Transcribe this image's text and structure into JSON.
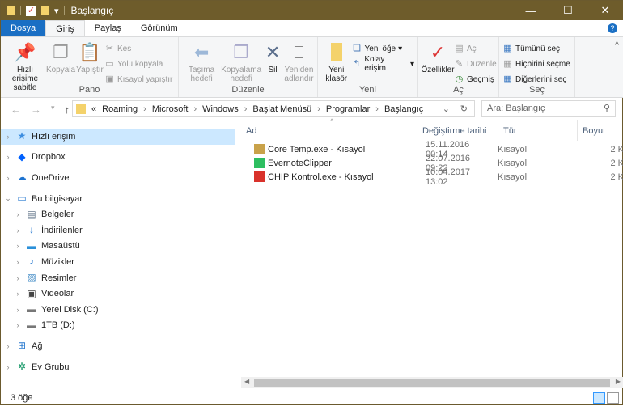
{
  "window": {
    "title": "Başlangıç",
    "minimize": "—",
    "maximize": "☐",
    "close": "✕"
  },
  "tabs": [
    {
      "label": "Dosya"
    },
    {
      "label": "Giriş"
    },
    {
      "label": "Paylaş"
    },
    {
      "label": "Görünüm"
    }
  ],
  "help": "?",
  "ribbon": {
    "pano": {
      "label": "Pano",
      "pin": "Hızlı erişime sabitle",
      "copy": "Kopyala",
      "paste": "Yapıştır",
      "cut": "Kes",
      "copy_path": "Yolu kopyala",
      "paste_shortcut": "Kısayol yapıştır"
    },
    "duzenle": {
      "label": "Düzenle",
      "move_to": "Taşıma hedefi",
      "copy_to": "Kopyalama hedefi",
      "delete": "Sil",
      "rename": "Yeniden adlandır"
    },
    "yeni": {
      "label": "Yeni",
      "new_folder": "Yeni klasör",
      "new_item": "Yeni öğe",
      "easy_access": "Kolay erişim"
    },
    "ac": {
      "label": "Aç",
      "properties": "Özellikler",
      "open": "Aç",
      "edit": "Düzenle",
      "history": "Geçmiş"
    },
    "sec": {
      "label": "Seç",
      "select_all": "Tümünü seç",
      "select_none": "Hiçbirini seçme",
      "invert": "Diğerlerini seç"
    }
  },
  "address": {
    "prefix": "«",
    "crumbs": [
      "Roaming",
      "Microsoft",
      "Windows",
      "Başlat Menüsü",
      "Programlar",
      "Başlangıç"
    ],
    "search_placeholder": "Ara: Başlangıç"
  },
  "nav": [
    {
      "label": "Hızlı erişim",
      "icon": "star-icon",
      "selected": true
    },
    {
      "label": "Dropbox",
      "icon": "dropbox-icon"
    },
    {
      "label": "OneDrive",
      "icon": "cloud-icon"
    },
    {
      "label": "Bu bilgisayar",
      "icon": "computer-icon",
      "expanded": true
    },
    {
      "label": "Belgeler",
      "icon": "documents-icon",
      "child": true
    },
    {
      "label": "İndirilenler",
      "icon": "download-icon",
      "child": true
    },
    {
      "label": "Masaüstü",
      "icon": "desktop-icon",
      "child": true
    },
    {
      "label": "Müzikler",
      "icon": "music-icon",
      "child": true
    },
    {
      "label": "Resimler",
      "icon": "pictures-icon",
      "child": true
    },
    {
      "label": "Videolar",
      "icon": "video-icon",
      "child": true
    },
    {
      "label": "Yerel Disk (C:)",
      "icon": "drive-icon",
      "child": true
    },
    {
      "label": "1TB (D:)",
      "icon": "drive-icon",
      "child": true
    },
    {
      "label": "Ağ",
      "icon": "network-icon"
    },
    {
      "label": "Ev Grubu",
      "icon": "homegroup-icon"
    }
  ],
  "columns": [
    "Ad",
    "Değiştirme tarihi",
    "Tür",
    "Boyut"
  ],
  "files": [
    {
      "name": "Core Temp.exe - Kısayol",
      "date": "15.11.2016 00:14",
      "type": "Kısayol",
      "size": "2 K",
      "color": "#c9a24a"
    },
    {
      "name": "EvernoteClipper",
      "date": "22.07.2016 09:22",
      "type": "Kısayol",
      "size": "2 K",
      "color": "#2dbe60"
    },
    {
      "name": "CHIP Kontrol.exe - Kısayol",
      "date": "10.04.2017 13:02",
      "type": "Kısayol",
      "size": "2 K",
      "color": "#d9322b"
    }
  ],
  "status": "3 öğe"
}
